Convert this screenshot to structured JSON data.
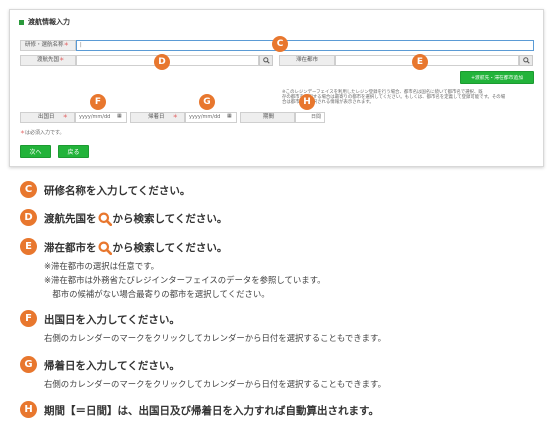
{
  "form": {
    "title": "渡航情報入力",
    "training_name_label": "研修・選航名称",
    "destination_country_label": "渡航先国",
    "stay_city_label": "滞在都市",
    "add_city_button": "+渡航先・滞在都市追加",
    "city_note": [
      "※このレジンデーフェイスを利用したレジン登録を行う場合、都市名は国名に続いて都市名で選択、既",
      "存の都市を選択する場合は最寄りの都市を選択してください。もしくは、都市名を定義して登録可能です。その場",
      "合は都市名で選択される情報が表示されます。"
    ],
    "departure_label": "出国日",
    "return_label": "帰着日",
    "period_label": "期間",
    "date_placeholder": "yyyy/mm/dd",
    "period_unit": "日間",
    "required_note": "は必須入力です。",
    "required_star": "＊",
    "next_button": "次へ",
    "back_button": "戻る",
    "badges": [
      "C",
      "D",
      "E",
      "F",
      "G",
      "H"
    ]
  },
  "instructions": [
    {
      "badge": "C",
      "head": "研修名称を入力してください。",
      "sub": []
    },
    {
      "badge": "D",
      "head_pre": "渡航先国を",
      "head_post": "から検索してください。",
      "sub": []
    },
    {
      "badge": "E",
      "head_pre": "滞在都市を",
      "head_post": "から検索してください。",
      "sub": [
        "※滞在都市の選択は任意です。",
        "※滞在都市は外務省たびレジインターフェイスのデータを参照しています。",
        "　都市の候補がない場合最寄りの都市を選択してください。"
      ]
    },
    {
      "badge": "F",
      "head": "出国日を入力してください。",
      "sub": [
        "右側のカレンダーのマークをクリックしてカレンダーから日付を選択することもできます。"
      ]
    },
    {
      "badge": "G",
      "head": "帰着日を入力してください。",
      "sub": [
        "右側のカレンダーのマークをクリックしてカレンダーから日付を選択することもできます。"
      ]
    },
    {
      "badge": "H",
      "head": "期間【＝日間】は、出国日及び帰着日を入力すれば自動算出されます。",
      "sub": []
    }
  ],
  "colors": {
    "badge": "#e8772e",
    "green_button": "#22b33a",
    "search_icon": "#e8772e"
  },
  "icons": {
    "search": "magnifier-icon",
    "calendar": "calendar-icon"
  }
}
